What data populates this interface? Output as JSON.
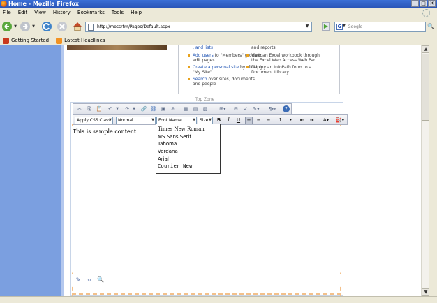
{
  "window": {
    "title": "Home - Mozilla Firefox"
  },
  "menu": [
    "File",
    "Edit",
    "View",
    "History",
    "Bookmarks",
    "Tools",
    "Help"
  ],
  "address": {
    "url": "http://mossrtm/Pages/Default.aspx"
  },
  "search": {
    "placeholder": "Google"
  },
  "bookmarks": [
    "Getting Started",
    "Latest Headlines"
  ],
  "gettingStarted": {
    "left": [
      {
        "link": "",
        "text": ", and lists"
      },
      {
        "link": "Add users",
        "text": " to \"Members\" group to edit pages"
      },
      {
        "link": "Create a personal site",
        "text": " by clicking \"My Site\""
      },
      {
        "link": "Search",
        "text": " over sites, documents, and people"
      }
    ],
    "right": [
      {
        "text": "and reports"
      },
      {
        "text": "View an Excel workbook through the Excel Web Access Web Part"
      },
      {
        "text": "Deploy an InfoPath form to a Document Library"
      }
    ]
  },
  "zoneLabel": "Top Zone",
  "editor": {
    "cssSelect": "Apply CSS Class",
    "styleSelect": "Normal",
    "fontSelect": "Font Name",
    "sizeSelect": "Size",
    "content": "This is sample content",
    "fontOptions": [
      "Times New Roman",
      "MS Sans Serif",
      "Tahoma",
      "Verdana",
      "Arial",
      "Courier New"
    ]
  },
  "colors": {
    "titlebar": "#2a55b8",
    "sidebar": "#7b9fe0",
    "zoneBorder": "#f3c08a",
    "link": "#2155b4"
  }
}
